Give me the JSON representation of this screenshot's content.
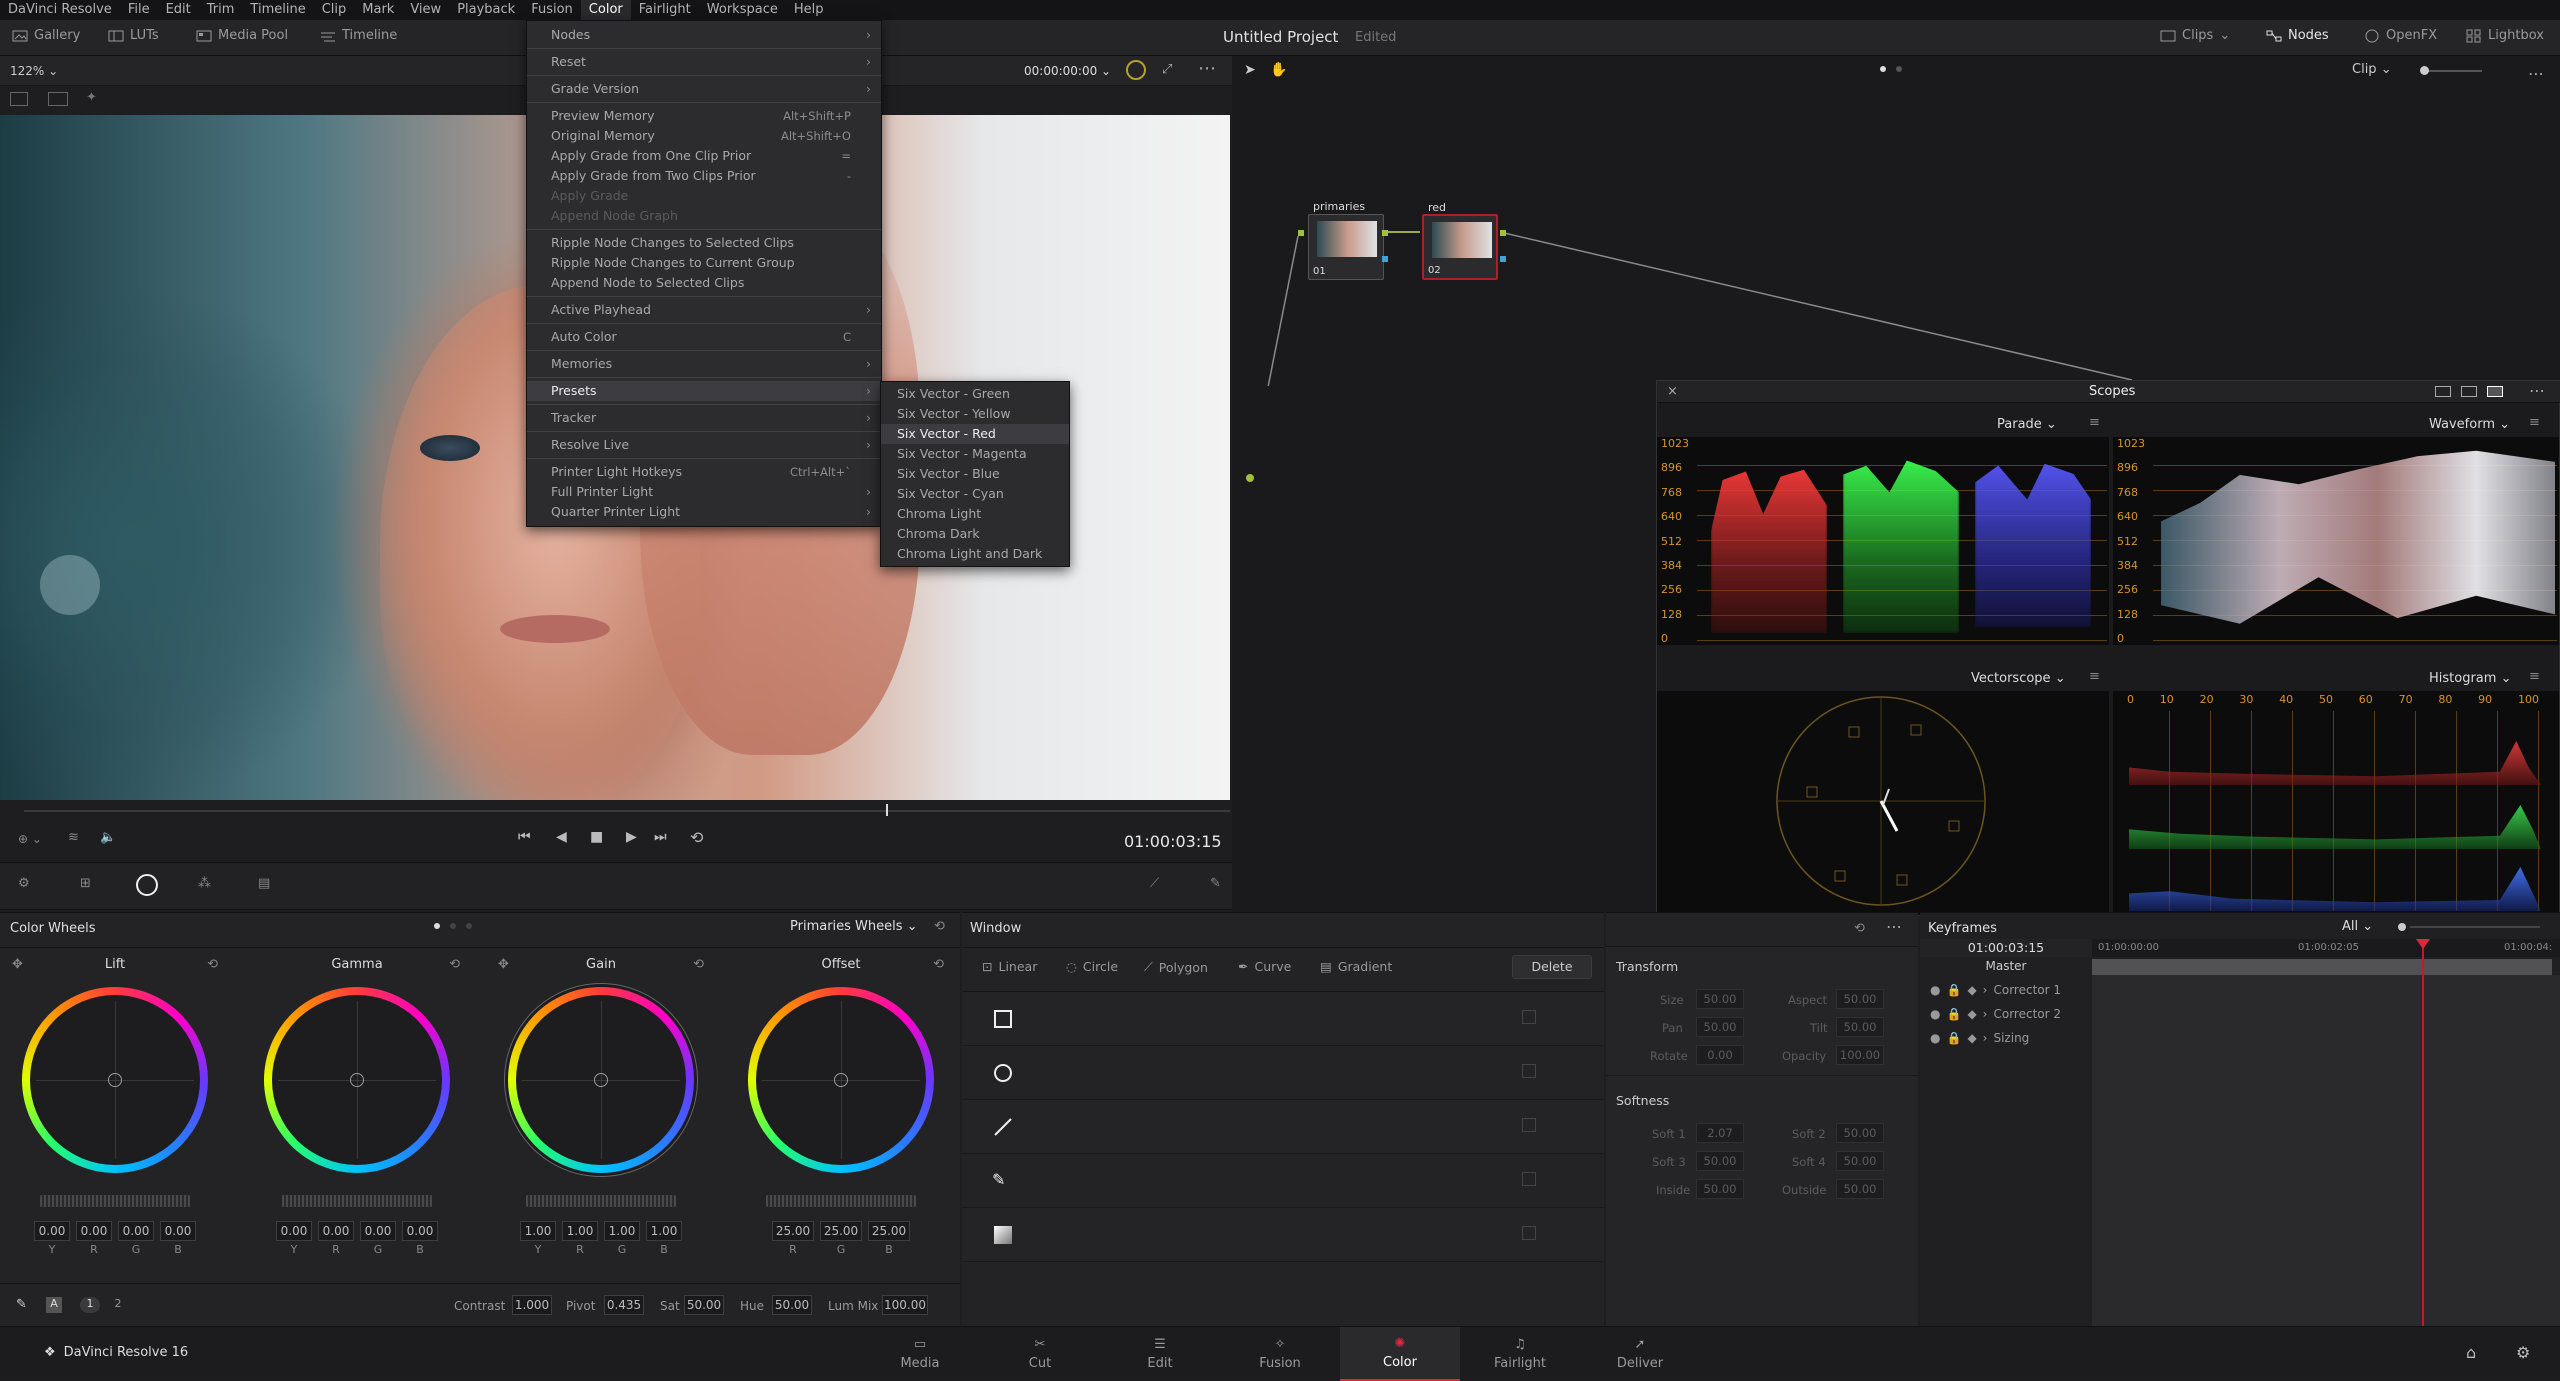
{
  "menubar": {
    "items": [
      "DaVinci Resolve",
      "File",
      "Edit",
      "Trim",
      "Timeline",
      "Clip",
      "Mark",
      "View",
      "Playback",
      "Fusion",
      "Color",
      "Fairlight",
      "Workspace",
      "Help"
    ]
  },
  "toolbar": {
    "gallery": "Gallery",
    "luts": "LUTs",
    "media_pool": "Media Pool",
    "timeline": "Timeline",
    "project_title": "Untitled Project",
    "project_status": "Edited",
    "clips": "Clips",
    "nodes": "Nodes",
    "openfx": "OpenFX",
    "lightbox": "Lightbox"
  },
  "viewer": {
    "zoom": "122%",
    "timecode_top": "00:00:00:00",
    "timecode": "01:00:03:15",
    "clip_mode": "Clip"
  },
  "color_menu": {
    "items": [
      {
        "label": "Nodes",
        "shortcut": "",
        "submenu": true,
        "disabled": false,
        "sep_after": true
      },
      {
        "label": "Reset",
        "shortcut": "",
        "submenu": true,
        "disabled": false,
        "sep_after": true
      },
      {
        "label": "Grade Version",
        "shortcut": "",
        "submenu": true,
        "disabled": false,
        "sep_after": true
      },
      {
        "label": "Preview Memory",
        "shortcut": "Alt+Shift+P",
        "submenu": false,
        "disabled": false,
        "sep_after": false
      },
      {
        "label": "Original Memory",
        "shortcut": "Alt+Shift+O",
        "submenu": false,
        "disabled": false,
        "sep_after": false
      },
      {
        "label": "Apply Grade from One Clip Prior",
        "shortcut": "=",
        "submenu": false,
        "disabled": false,
        "sep_after": false
      },
      {
        "label": "Apply Grade from Two Clips Prior",
        "shortcut": "-",
        "submenu": false,
        "disabled": false,
        "sep_after": false
      },
      {
        "label": "Apply Grade",
        "shortcut": "",
        "submenu": false,
        "disabled": true,
        "sep_after": false
      },
      {
        "label": "Append Node Graph",
        "shortcut": "",
        "submenu": false,
        "disabled": true,
        "sep_after": true
      },
      {
        "label": "Ripple Node Changes to Selected Clips",
        "shortcut": "",
        "submenu": false,
        "disabled": false,
        "sep_after": false
      },
      {
        "label": "Ripple Node Changes to Current Group",
        "shortcut": "",
        "submenu": false,
        "disabled": false,
        "sep_after": false
      },
      {
        "label": "Append Node to Selected Clips",
        "shortcut": "",
        "submenu": false,
        "disabled": false,
        "sep_after": true
      },
      {
        "label": "Active Playhead",
        "shortcut": "",
        "submenu": true,
        "disabled": false,
        "sep_after": true
      },
      {
        "label": "Auto Color",
        "shortcut": "C",
        "submenu": false,
        "disabled": false,
        "sep_after": true
      },
      {
        "label": "Memories",
        "shortcut": "",
        "submenu": true,
        "disabled": false,
        "sep_after": true
      },
      {
        "label": "Presets",
        "shortcut": "",
        "submenu": true,
        "disabled": false,
        "sep_after": true,
        "highlight": true
      },
      {
        "label": "Tracker",
        "shortcut": "",
        "submenu": true,
        "disabled": false,
        "sep_after": true
      },
      {
        "label": "Resolve Live",
        "shortcut": "",
        "submenu": true,
        "disabled": false,
        "sep_after": true
      },
      {
        "label": "Printer Light Hotkeys",
        "shortcut": "Ctrl+Alt+`",
        "submenu": false,
        "disabled": false,
        "sep_after": false
      },
      {
        "label": "Full Printer Light",
        "shortcut": "",
        "submenu": true,
        "disabled": false,
        "sep_after": false
      },
      {
        "label": "Quarter Printer Light",
        "shortcut": "",
        "submenu": true,
        "disabled": false,
        "sep_after": false
      }
    ]
  },
  "presets_menu": {
    "items": [
      {
        "label": "Six Vector - Green",
        "highlight": false
      },
      {
        "label": "Six Vector - Yellow",
        "highlight": false
      },
      {
        "label": "Six Vector - Red",
        "highlight": true
      },
      {
        "label": "Six Vector - Magenta",
        "highlight": false
      },
      {
        "label": "Six Vector - Blue",
        "highlight": false
      },
      {
        "label": "Six Vector - Cyan",
        "highlight": false
      },
      {
        "label": "Chroma Light",
        "highlight": false
      },
      {
        "label": "Chroma Dark",
        "highlight": false
      },
      {
        "label": "Chroma Light and Dark",
        "highlight": false
      }
    ]
  },
  "nodes": {
    "node1_label": "primaries",
    "node1_num": "01",
    "node2_label": "red",
    "node2_num": "02"
  },
  "scopes": {
    "title": "Scopes",
    "parade": "Parade",
    "waveform": "Waveform",
    "vectorscope": "Vectorscope",
    "histogram": "Histogram",
    "y_ticks": [
      "1023",
      "896",
      "768",
      "640",
      "512",
      "384",
      "256",
      "128",
      "0"
    ],
    "hist_ticks": [
      "0",
      "10",
      "20",
      "30",
      "40",
      "50",
      "60",
      "70",
      "80",
      "90",
      "100"
    ]
  },
  "color_wheels": {
    "title": "Color Wheels",
    "mode": "Primaries Wheels",
    "wheels": [
      {
        "name": "Lift",
        "values": [
          "0.00",
          "0.00",
          "0.00",
          "0.00"
        ]
      },
      {
        "name": "Gamma",
        "values": [
          "0.00",
          "0.00",
          "0.00",
          "0.00"
        ]
      },
      {
        "name": "Gain",
        "values": [
          "1.00",
          "1.00",
          "1.00",
          "1.00"
        ]
      },
      {
        "name": "Offset",
        "values": [
          "25.00",
          "25.00",
          "25.00"
        ]
      }
    ],
    "channel_labels": [
      "Y",
      "R",
      "G",
      "B"
    ],
    "offset_labels": [
      "R",
      "G",
      "B"
    ],
    "page1": "1",
    "page2": "2",
    "a_label": "A",
    "contrast_label": "Contrast",
    "contrast": "1.000",
    "pivot_label": "Pivot",
    "pivot": "0.435",
    "sat_label": "Sat",
    "sat": "50.00",
    "hue_label": "Hue",
    "hue": "50.00",
    "lummix_label": "Lum Mix",
    "lummix": "100.00"
  },
  "window_panel": {
    "title": "Window",
    "linear": "Linear",
    "circle": "Circle",
    "polygon": "Polygon",
    "curve": "Curve",
    "gradient": "Gradient",
    "delete": "Delete",
    "transform": "Transform",
    "softness": "Softness",
    "size_l": "Size",
    "size_v": "50.00",
    "aspect_l": "Aspect",
    "aspect_v": "50.00",
    "pan_l": "Pan",
    "pan_v": "50.00",
    "tilt_l": "Tilt",
    "tilt_v": "50.00",
    "rotate_l": "Rotate",
    "rotate_v": "0.00",
    "opacity_l": "Opacity",
    "opacity_v": "100.00",
    "soft1_l": "Soft 1",
    "soft1_v": "2.07",
    "soft2_l": "Soft 2",
    "soft2_v": "50.00",
    "soft3_l": "Soft 3",
    "soft3_v": "50.00",
    "soft4_l": "Soft 4",
    "soft4_v": "50.00",
    "inside_l": "Inside",
    "inside_v": "50.00",
    "outside_l": "Outside",
    "outside_v": "50.00"
  },
  "keyframes": {
    "title": "Keyframes",
    "filter": "All",
    "timecode": "01:00:03:15",
    "t1": "01:00:00:00",
    "t2": "01:00:02:05",
    "t3": "01:00:04:",
    "master": "Master",
    "tracks": [
      "Corrector 1",
      "Corrector 2",
      "Sizing"
    ]
  },
  "pagebar": {
    "brand": "DaVinci Resolve 16",
    "pages": [
      "Media",
      "Cut",
      "Edit",
      "Fusion",
      "Color",
      "Fairlight",
      "Deliver"
    ],
    "active": "Color"
  },
  "colors": {
    "accent": "#e0263d",
    "menu_bg": "#2c2c2f"
  }
}
